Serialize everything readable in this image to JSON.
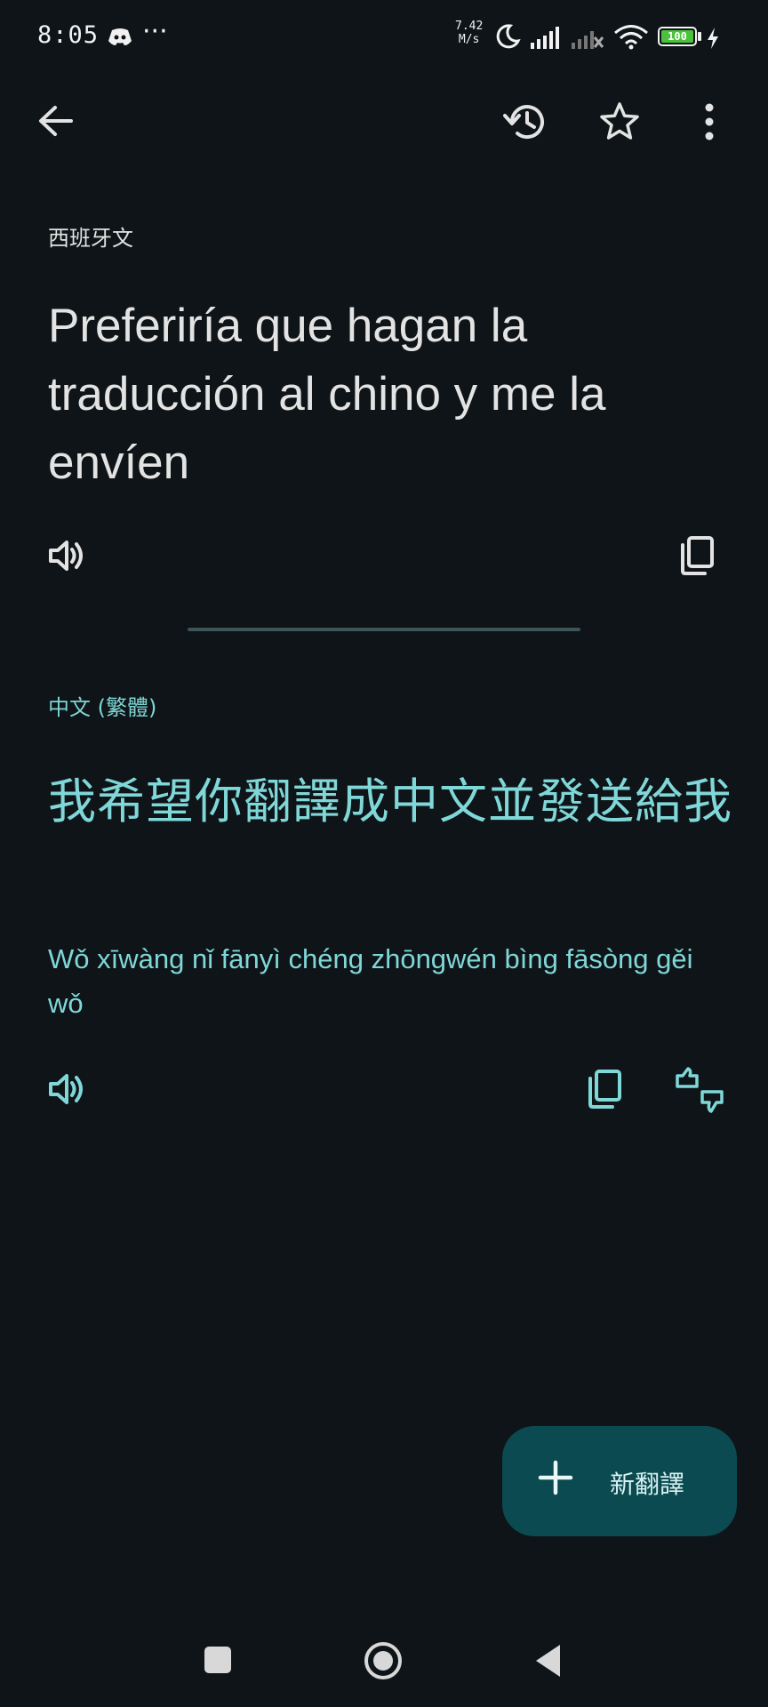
{
  "status_bar": {
    "time": "8:05",
    "more": "···",
    "speed_value": "7.42",
    "speed_unit": "M/s",
    "battery": "100"
  },
  "toolbar": {
    "back_icon": "arrow-back-icon",
    "history_icon": "history-icon",
    "star_icon": "star-outline-icon",
    "menu_icon": "more-vert-icon"
  },
  "source": {
    "language": "西班牙文",
    "text": "Preferiría que hagan la traducción al chino y me la envíen"
  },
  "target": {
    "language": "中文 (繁體)",
    "text": "我希望你翻譯成中文並發送給我",
    "pinyin": "Wǒ xīwàng nǐ fānyì chéng zhōngwén bìng fāsòng gěi wǒ"
  },
  "fab": {
    "label": "新翻譯"
  },
  "colors": {
    "background": "#0e1417",
    "accent": "#80d7d8",
    "fab": "#0b4a50"
  }
}
